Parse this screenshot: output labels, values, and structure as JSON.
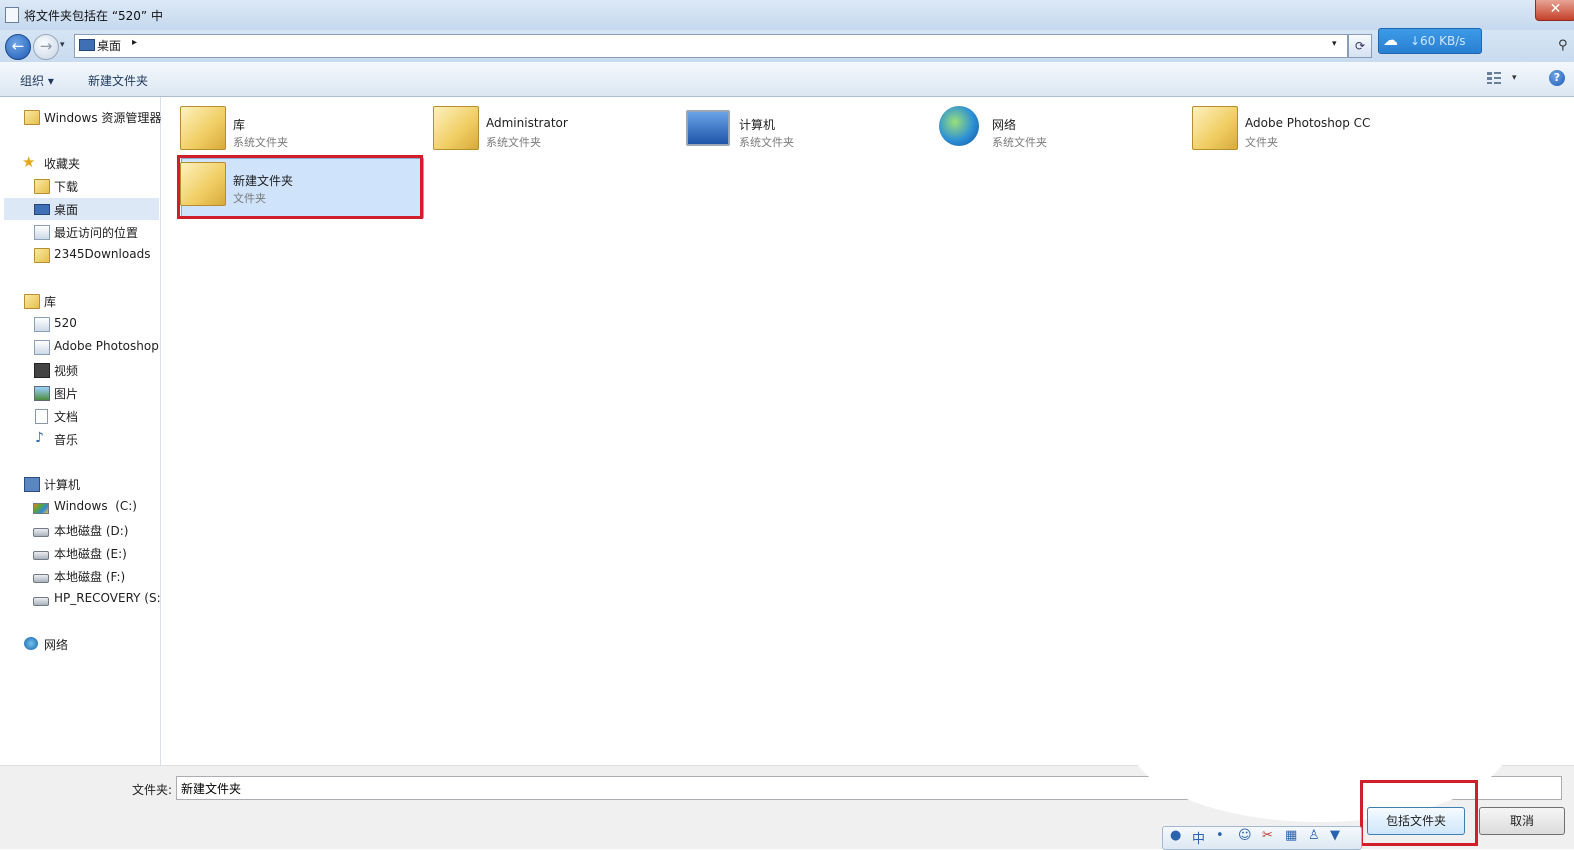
{
  "window": {
    "title": "将文件夹包括在 “520” 中",
    "close_glyph": "✕"
  },
  "address": {
    "location": "桌面",
    "separator": "▸",
    "dropdown": "▾"
  },
  "speed_widget": {
    "text": "↓60 KB/s"
  },
  "toolbar": {
    "organize_label": "组织 ▾",
    "new_folder_label": "新建文件夹",
    "view_dropdown": "▾",
    "help": "?"
  },
  "nav": {
    "explorer": "Windows 资源管理器",
    "favorites": "收藏夹",
    "fav_items": [
      "下载",
      "桌面",
      "最近访问的位置",
      "2345Downloads"
    ],
    "libraries": "库",
    "lib_items": [
      "520",
      "Adobe Photoshop",
      "视频",
      "图片",
      "文档",
      "音乐"
    ],
    "computer": "计算机",
    "drives": [
      "Windows  (C:)",
      "本地磁盘 (D:)",
      "本地磁盘 (E:)",
      "本地磁盘 (F:)",
      "HP_RECOVERY (S:)"
    ],
    "network": "网络"
  },
  "items": [
    {
      "name": "库",
      "type": "系统文件夹"
    },
    {
      "name": "Administrator",
      "type": "系统文件夹"
    },
    {
      "name": "计算机",
      "type": "系统文件夹"
    },
    {
      "name": "网络",
      "type": "系统文件夹"
    },
    {
      "name": "Adobe Photoshop CC",
      "type": "文件夹"
    },
    {
      "name": "新建文件夹",
      "type": "文件夹"
    }
  ],
  "bottom": {
    "folder_label": "文件夹:",
    "folder_value": "新建文件夹",
    "include_button": "包括文件夹",
    "cancel_button": "取消"
  },
  "ime": {
    "lang": "中"
  },
  "colors": {
    "highlight_red": "#d01e2a",
    "selection_blue": "#cfe3fb",
    "titlebar": "#c5d8ee"
  }
}
